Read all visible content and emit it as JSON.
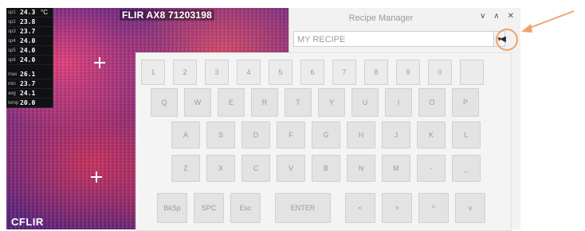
{
  "camera": {
    "title": "FLIR AX8 71203198",
    "logo": "CFLIR",
    "readings": [
      {
        "label": "sp1",
        "value": "24.3",
        "unit": "°C"
      },
      {
        "label": "sp2",
        "value": "23.8",
        "unit": ""
      },
      {
        "label": "sp3",
        "value": "23.7",
        "unit": ""
      },
      {
        "label": "sp4",
        "value": "24.0",
        "unit": ""
      },
      {
        "label": "sp5",
        "value": "24.0",
        "unit": ""
      },
      {
        "label": "sp6",
        "value": "24.0",
        "unit": ""
      },
      {
        "label": "max",
        "value": "26.1",
        "unit": ""
      },
      {
        "label": "min",
        "value": "23.7",
        "unit": ""
      },
      {
        "label": "avg",
        "value": "24.1",
        "unit": ""
      },
      {
        "label": "temp",
        "value": "20.0",
        "unit": ""
      }
    ]
  },
  "window": {
    "title": "Recipe Manager",
    "controls": {
      "minimize": "∨",
      "maximize": "∧",
      "close": "✕"
    },
    "recipe_input": {
      "value": "MY RECIPE"
    },
    "dropdown_icon": "▾",
    "back_icon": "◀"
  },
  "keyboard": {
    "rows": [
      [
        "1",
        "2",
        "3",
        "4",
        "5",
        "6",
        "7",
        "8",
        "9",
        "0",
        "."
      ],
      [
        "Q",
        "W",
        "E",
        "R",
        "T",
        "Y",
        "U",
        "I",
        "O",
        "P"
      ],
      [
        "A",
        "S",
        "D",
        "F",
        "G",
        "H",
        "J",
        "K",
        "L"
      ],
      [
        "Z",
        "X",
        "C",
        "V",
        "B",
        "N",
        "M",
        "-",
        "_"
      ],
      [
        "BkSp",
        "SPC",
        "Esc",
        "ENTER",
        "<",
        ">",
        "^",
        "v"
      ]
    ]
  },
  "annotation": {
    "accent": "#f2a06a"
  }
}
